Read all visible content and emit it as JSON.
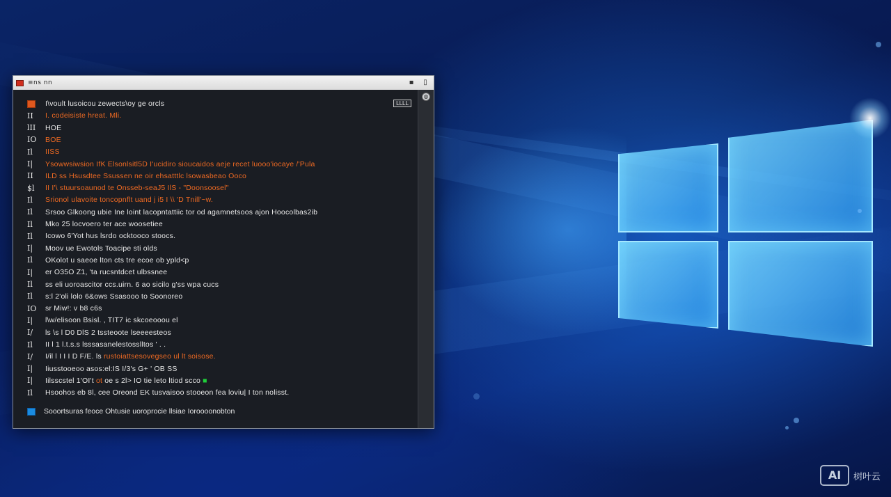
{
  "window": {
    "title": "≡ns   nn",
    "badge": "LLLL",
    "controls": [
      "▪",
      "▯"
    ],
    "scroll_glyph": "◍"
  },
  "terminal": {
    "lines": [
      {
        "gutter": "",
        "text": "I\\voult lusoicou zewects\\oy ge orcls",
        "color": "white",
        "icon": true
      },
      {
        "gutter": "II",
        "text": "I. codeisiste hreat. Mli.",
        "color": "orange"
      },
      {
        "gutter": "lII",
        "text": "HOE",
        "color": "white"
      },
      {
        "gutter": "IO",
        "text": "BOE",
        "color": "orange"
      },
      {
        "gutter": "Il",
        "text": "IISS",
        "color": "orange"
      },
      {
        "gutter": "I|",
        "text": "Ysowwsiwsion IfK  Elsonlsitl5D  I'ucidiro   sioucaidos aeje  recet luooo'iocaye /'Pula",
        "color": "orange"
      },
      {
        "gutter": "II",
        "text": "ILD ss Hsusdtee Ssussen ne oir ehsatttlc lsowasbeao Ooco",
        "color": "orange"
      },
      {
        "gutter": "$l",
        "text": "II I'\\ stuursoaunod te Onsseb-seaJ5  IlS - \"Doonsoosel\"",
        "color": "orange"
      },
      {
        "gutter": "Il",
        "text": "Srionol ulavoite  toncopnflt uand j  i5 I \\\\ 'D  Tnill'~w.",
        "color": "orange"
      },
      {
        "gutter": "Il",
        "text": "Srsoo Glkoong ubie Ine loint  lacopntattiic tor od agamnetsoos ajon  Hoocolbas2ib",
        "color": "white"
      },
      {
        "gutter": "Il",
        "text": "Mko 25  locvoero ter ace woosetiee",
        "color": "white"
      },
      {
        "gutter": "Il",
        "text": "Icowo 6'Yot hus  lsrdo  ocktooco stoocs.",
        "color": "white"
      },
      {
        "gutter": "I|",
        "text": "Moov ue Ewotols  Toacipe sti olds",
        "color": "white"
      },
      {
        "gutter": "Il",
        "text": "OKolot u saeoe  lton cts  tre ecoe ob ypld<p",
        "color": "white"
      },
      {
        "gutter": "I|",
        "text": "er O35O  Z1, 'ta rucsntdcet ulbssnee",
        "color": "white"
      },
      {
        "gutter": "Il",
        "text": "ss eli uoroascitor  ccs.uirn.  6 ao sicilo g'ss  wpa cucs",
        "color": "white"
      },
      {
        "gutter": "Il",
        "text": "s:l  2'oli lolo 6&ows  Ssasooo  to  Soonoreo",
        "color": "white"
      },
      {
        "gutter": "IO",
        "text": "sr Miw!: v b8 c6s",
        "color": "white"
      },
      {
        "gutter": "I|",
        "text": "l\\w/elisoon Bsisl.   ,  TIT7  ic skcoeooou el",
        "color": "white"
      },
      {
        "gutter": "I/",
        "text": "ls \\s  l  D0  DlS 2 tssteoote lseeeesteos",
        "color": "white"
      },
      {
        "gutter": "Il",
        "text": "II l 1 l.t.s.s lsssasanelestosslltos  ' .  .",
        "color": "white"
      },
      {
        "gutter": "I/",
        "text": "I/il l I I I  D  F/E.  ls  rustoiattsesovegseo ul lt soisose.",
        "color": "mixed",
        "segments": [
          {
            "t": "I/il l I I I  D  F/E.  ls  ",
            "c": "w"
          },
          {
            "t": "rustoiattsesovegseo ul lt soisose.",
            "c": "o"
          }
        ]
      },
      {
        "gutter": "I|",
        "text": "Iiusstooeoo asos:el:IS  I/3's   G+ ' OB  SS",
        "color": "white"
      },
      {
        "gutter": "I|",
        "text": "Iilsscstel  1'OI't ot   oe   s  2l>  IO  tie  leto  ltiod  scco",
        "color": "mixed",
        "segments": [
          {
            "t": "Iilsscstel  1'OI't ",
            "c": "w"
          },
          {
            "t": "ot",
            "c": "o"
          },
          {
            "t": "   oe   s  2l>  IO  tie  leto  ltiod  scco ",
            "c": "w"
          },
          {
            "t": "■",
            "c": "g"
          }
        ]
      },
      {
        "gutter": "Il",
        "text": "Hsoohos eb 8l, cee Oreond  EK  tusvaisoo  stooeon  fea  loviu|  I  ton nolisst.",
        "color": "white"
      }
    ],
    "footer": "Sooortsuras feoce  Ohtusie  uoroprocie llsiae  Ioroooonobton"
  },
  "watermark": {
    "logo": "AI",
    "text": "树叶云"
  }
}
